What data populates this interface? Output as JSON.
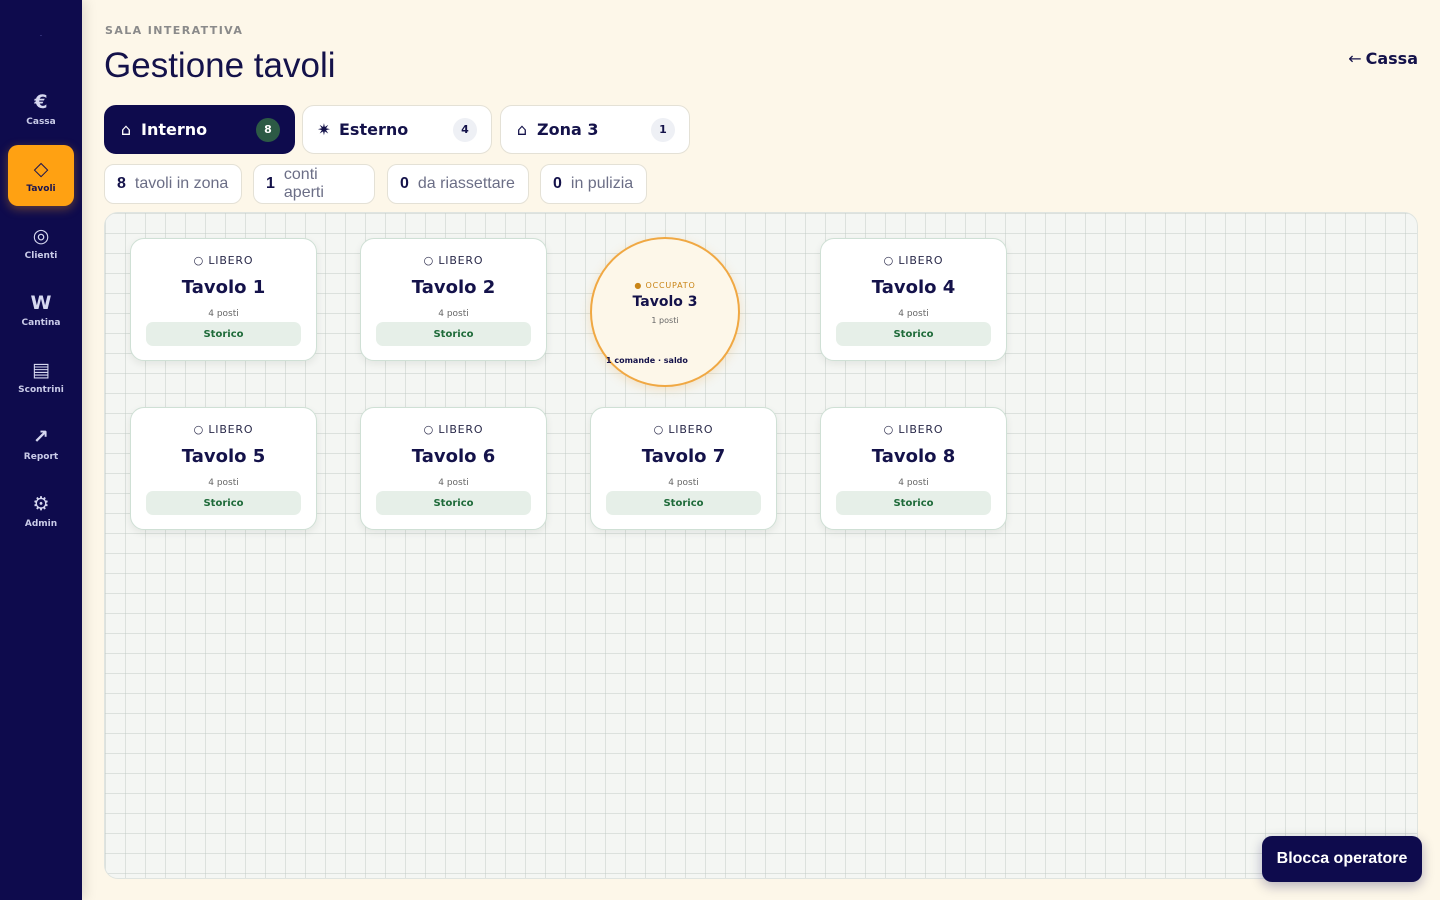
{
  "sidebar": {
    "logo": ".",
    "items": [
      {
        "icon": "€",
        "icon_name": "euro-icon",
        "label": "Cassa",
        "active": false
      },
      {
        "icon": "◇",
        "icon_name": "diamond-icon",
        "label": "Tavoli",
        "active": true
      },
      {
        "icon": "◎",
        "icon_name": "ring-icon",
        "label": "Clienti",
        "active": false
      },
      {
        "icon": "W",
        "icon_name": "wine-w-icon",
        "label": "Cantina",
        "active": false
      },
      {
        "icon": "▤",
        "icon_name": "receipt-icon",
        "label": "Scontrini",
        "active": false
      },
      {
        "icon": "↗",
        "icon_name": "trend-arrow-icon",
        "label": "Report",
        "active": false
      },
      {
        "icon": "⚙",
        "icon_name": "gear-icon",
        "label": "Admin",
        "active": false
      }
    ]
  },
  "header": {
    "eyebrow": "SALA INTERATTIVA",
    "title": "Gestione tavoli",
    "back_arrow": "←",
    "back_label": "Cassa"
  },
  "zones": [
    {
      "icon": "⌂",
      "icon_name": "home-icon",
      "label": "Interno",
      "count": "8",
      "active": true
    },
    {
      "icon": "✷",
      "icon_name": "sun-icon",
      "label": "Esterno",
      "count": "4",
      "active": false
    },
    {
      "icon": "⌂",
      "icon_name": "home-icon",
      "label": "Zona 3",
      "count": "1",
      "active": false
    }
  ],
  "stats": [
    {
      "value": "8",
      "label": "tavoli in zona"
    },
    {
      "value": "1",
      "label": "conti aperti"
    },
    {
      "value": "0",
      "label": "da riassettare"
    },
    {
      "value": "0",
      "label": "in pulizia"
    }
  ],
  "tables": [
    {
      "status": "○ LIBERO",
      "name": "Tavolo 1",
      "seats": "4 posti",
      "action": "Storico",
      "shape": "rect"
    },
    {
      "status": "○ LIBERO",
      "name": "Tavolo 2",
      "seats": "4 posti",
      "action": "Storico",
      "shape": "rect"
    },
    {
      "status": "● OCCUPATO",
      "name": "Tavolo 3",
      "seats": "1 posti",
      "orders": "1 comande · saldo",
      "shape": "round"
    },
    {
      "status": "○ LIBERO",
      "name": "Tavolo 4",
      "seats": "4 posti",
      "action": "Storico",
      "shape": "rect"
    },
    {
      "status": "○ LIBERO",
      "name": "Tavolo 5",
      "seats": "4 posti",
      "action": "Storico",
      "shape": "rect"
    },
    {
      "status": "○ LIBERO",
      "name": "Tavolo 6",
      "seats": "4 posti",
      "action": "Storico",
      "shape": "rect"
    },
    {
      "status": "○ LIBERO",
      "name": "Tavolo 7",
      "seats": "4 posti",
      "action": "Storico",
      "shape": "rect"
    },
    {
      "status": "○ LIBERO",
      "name": "Tavolo 8",
      "seats": "4 posti",
      "action": "Storico",
      "shape": "rect"
    }
  ],
  "footer": {
    "lock_label": "Blocca operatore"
  }
}
